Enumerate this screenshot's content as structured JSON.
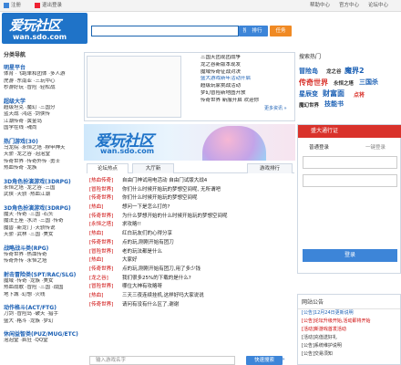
{
  "topbar": {
    "items": [
      "注册",
      "退出登录"
    ],
    "right": [
      "帮助中心",
      "官方中心",
      "论坛中心"
    ]
  },
  "header": {
    "logo_main": "爱玩社区",
    "logo_sub": "wan.sdo.com",
    "search_placeholder": "",
    "search_btn": "搜索",
    "btn_b": "排行",
    "btn_c": "任务"
  },
  "left": {
    "header": "分类导航",
    "groups": [
      {
        "title": "明星平台",
        "lines": [
          "体育 ·飞跑单和团体 ·多人游",
          "虎游 ·东南亚 ·三玩中心",
          "秒游好玩 ·冒险 ·轻松战"
        ]
      },
      {
        "title": "超级大学",
        "lines": [
          "超级坦克 ·魔幻 ·三国分",
          "蓝天战 ·鸿运 ·剑侠传",
          "江湖传奇 ·黄金岛",
          "国学在线 ·魂尚"
        ]
      },
      {
        "title": "热门游戏(30)",
        "lines": [
          "乌龙院 ·永恒之塔 ·穆甲神天",
          "天骄 ·龙之谷 ·泡泡堂",
          "传奇世界 ·传奇外传 ·勇士",
          "热血传奇 ·龙族"
        ]
      },
      {
        "title": "3D角色扮演游戏(3DRPG)",
        "lines": [
          "永恒之塔 ·龙之谷 ·三国",
          "武侠 ·天骄 ·热血江湖"
        ]
      },
      {
        "title": "3D角色扮演游戏(3DRPG)",
        "lines": [
          "魔天 ·传奇 ·三国 ·石头",
          "魔法王座 ·水浒 ·三国 ·传奇",
          "魔兽 ·新龙门 ·天骄传说",
          "天骄 ·武林 ·三国 ·美女"
        ]
      },
      {
        "title": "战略战斗类(RPG)",
        "lines": [
          "传奇世界 ·热血传奇",
          "传奇外传 ·永恒之塔"
        ]
      },
      {
        "title": "射击冒险类(SPT/RAC/SLG)",
        "lines": [
          "魔域 ·传奇 ·龙族 ·美女",
          "热血战歌 ·冒险 ·三国 ·战国",
          "地下城 ·幻想 ·火线"
        ]
      },
      {
        "title": "动作格斗(ACT/FTG)",
        "lines": [
          "刀剑 ·冒险岛 ·破天 ·猎手",
          "盛大 ·格斗 ·龙族 ·梦幻"
        ]
      },
      {
        "title": "休闲益智类(PUZ/MUG/ETC)",
        "lines": [
          "泡泡堂 ·疯狂 ·QQ堂"
        ]
      }
    ]
  },
  "featured": {
    "items": [
      "三国天团现团战争",
      "龙之谷新版本现发",
      "魔域传奇征战对决",
      "盛大游戏新年活动开启",
      "超级玩家挑战活动",
      "梦幻冒险新地图开放",
      "传奇世界 新服开启 欢迎你"
    ],
    "more": "更多资讯 »"
  },
  "hot": {
    "title": "搜索热门",
    "words": [
      "冒险岛",
      "龙之谷",
      "魔界2",
      "传奇世界",
      "永恒之塔",
      "三国杀",
      "星辰变",
      "财富面",
      "点将",
      "魔幻世界",
      "技能书"
    ]
  },
  "banner": {
    "title": "爱玩社区",
    "sub": "wan.sdo.com"
  },
  "tabs": [
    "论坛热点",
    "大厅新",
    "游戏排行"
  ],
  "news": [
    {
      "tag": "[热血传奇]",
      "title": "自由门神试用电活动 自由门试版大战4"
    },
    {
      "tag": "[冒险世界]",
      "title": "你们什么时候开始玩的梦想空间呢, 无所谓吧"
    },
    {
      "tag": "[传奇世界]",
      "title": "你们什么时候开始玩的梦想空间呢"
    },
    {
      "tag": "[热血]",
      "title": "想问一下是怎么打的?"
    },
    {
      "tag": "[传奇世界]",
      "title": "为什么梦想开始的什么时候开始玩的梦想空间呢"
    },
    {
      "tag": "[永恒之塔]",
      "title": "求攻略!!"
    },
    {
      "tag": "[热血]",
      "title": "红白玩友们的心得分享"
    },
    {
      "tag": "[传奇世界]",
      "title": "点的玩,刚刚开始有团刀"
    },
    {
      "tag": "[冒险世界]",
      "title": "老的玩法都是什么"
    },
    {
      "tag": "[热血]",
      "title": "大家好"
    },
    {
      "tag": "[传奇世界]",
      "title": "点的玩,刚刚开始有团刀,用了多少钱"
    },
    {
      "tag": "[龙之谷]",
      "title": "我们很多25%的下载的是什么?"
    },
    {
      "tag": "[冒险世界]",
      "title": "哪位大神有攻略呀"
    },
    {
      "tag": "[热血]",
      "title": "三天三夜连续挂机,这样好吗大家说说"
    },
    {
      "tag": "[传奇世界]",
      "title": "请问有没有什么区了,谢谢"
    }
  ],
  "news_more": "更多 »",
  "bottom_search": {
    "placeholder": "输入游戏名字",
    "btn": "快速搜索"
  },
  "login": {
    "title": "盛大通行证",
    "tab1": "普通登录",
    "tab2": "一键登录",
    "btn": "登录"
  },
  "notice": {
    "title": "网站公告",
    "items": [
      "[公告]12月24日更新说明",
      "[公告]论坛升级开始,活动即将开始",
      "[活动]新游戏首发活动",
      "[活动]充值送好礼",
      "[公告]系统维护说明",
      "[公告]交易须知"
    ]
  }
}
